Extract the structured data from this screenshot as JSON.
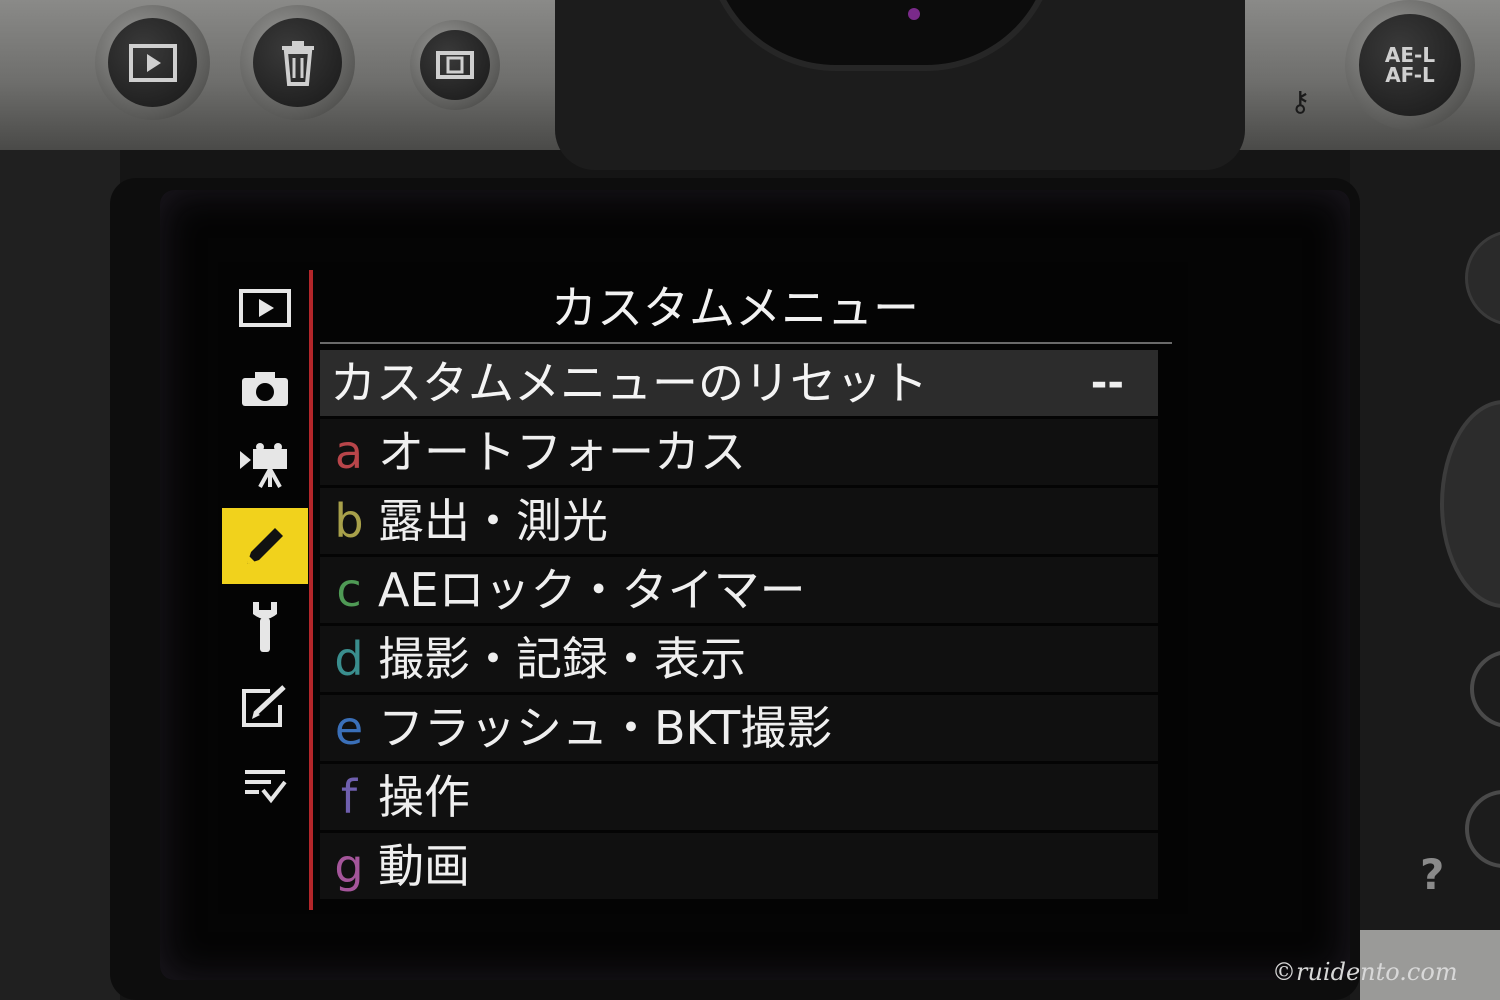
{
  "hardware": {
    "ae_af_lock_line1": "AE-L",
    "ae_af_lock_line2": "AF-L",
    "help_label": "?",
    "watermark": "©ruidento.com"
  },
  "sidebar": {
    "tabs": [
      {
        "icon": "playback-icon",
        "active": false
      },
      {
        "icon": "camera-icon",
        "active": false
      },
      {
        "icon": "movie-camera-icon",
        "active": false
      },
      {
        "icon": "pencil-icon",
        "active": true
      },
      {
        "icon": "wrench-icon",
        "active": false
      },
      {
        "icon": "retouch-icon",
        "active": false
      },
      {
        "icon": "my-menu-icon",
        "active": false
      }
    ],
    "active_color": "#f1d21c",
    "rule_color": "#b3262a"
  },
  "menu": {
    "title": "カスタムメニュー",
    "reset": {
      "label": "カスタムメニューのリセット",
      "value": "--"
    },
    "items": [
      {
        "letter": "a",
        "label": "オートフォーカス",
        "color": "#b8454a"
      },
      {
        "letter": "b",
        "label": "露出・測光",
        "color": "#a8a04a"
      },
      {
        "letter": "c",
        "label": "AEロック・タイマー",
        "color": "#4f9a55"
      },
      {
        "letter": "d",
        "label": "撮影・記録・表示",
        "color": "#3a8e8e"
      },
      {
        "letter": "e",
        "label": "フラッシュ・BKT撮影",
        "color": "#3a6fb8"
      },
      {
        "letter": "f",
        "label": "操作",
        "color": "#6f5fae"
      },
      {
        "letter": "g",
        "label": "動画",
        "color": "#a4559a"
      }
    ]
  }
}
